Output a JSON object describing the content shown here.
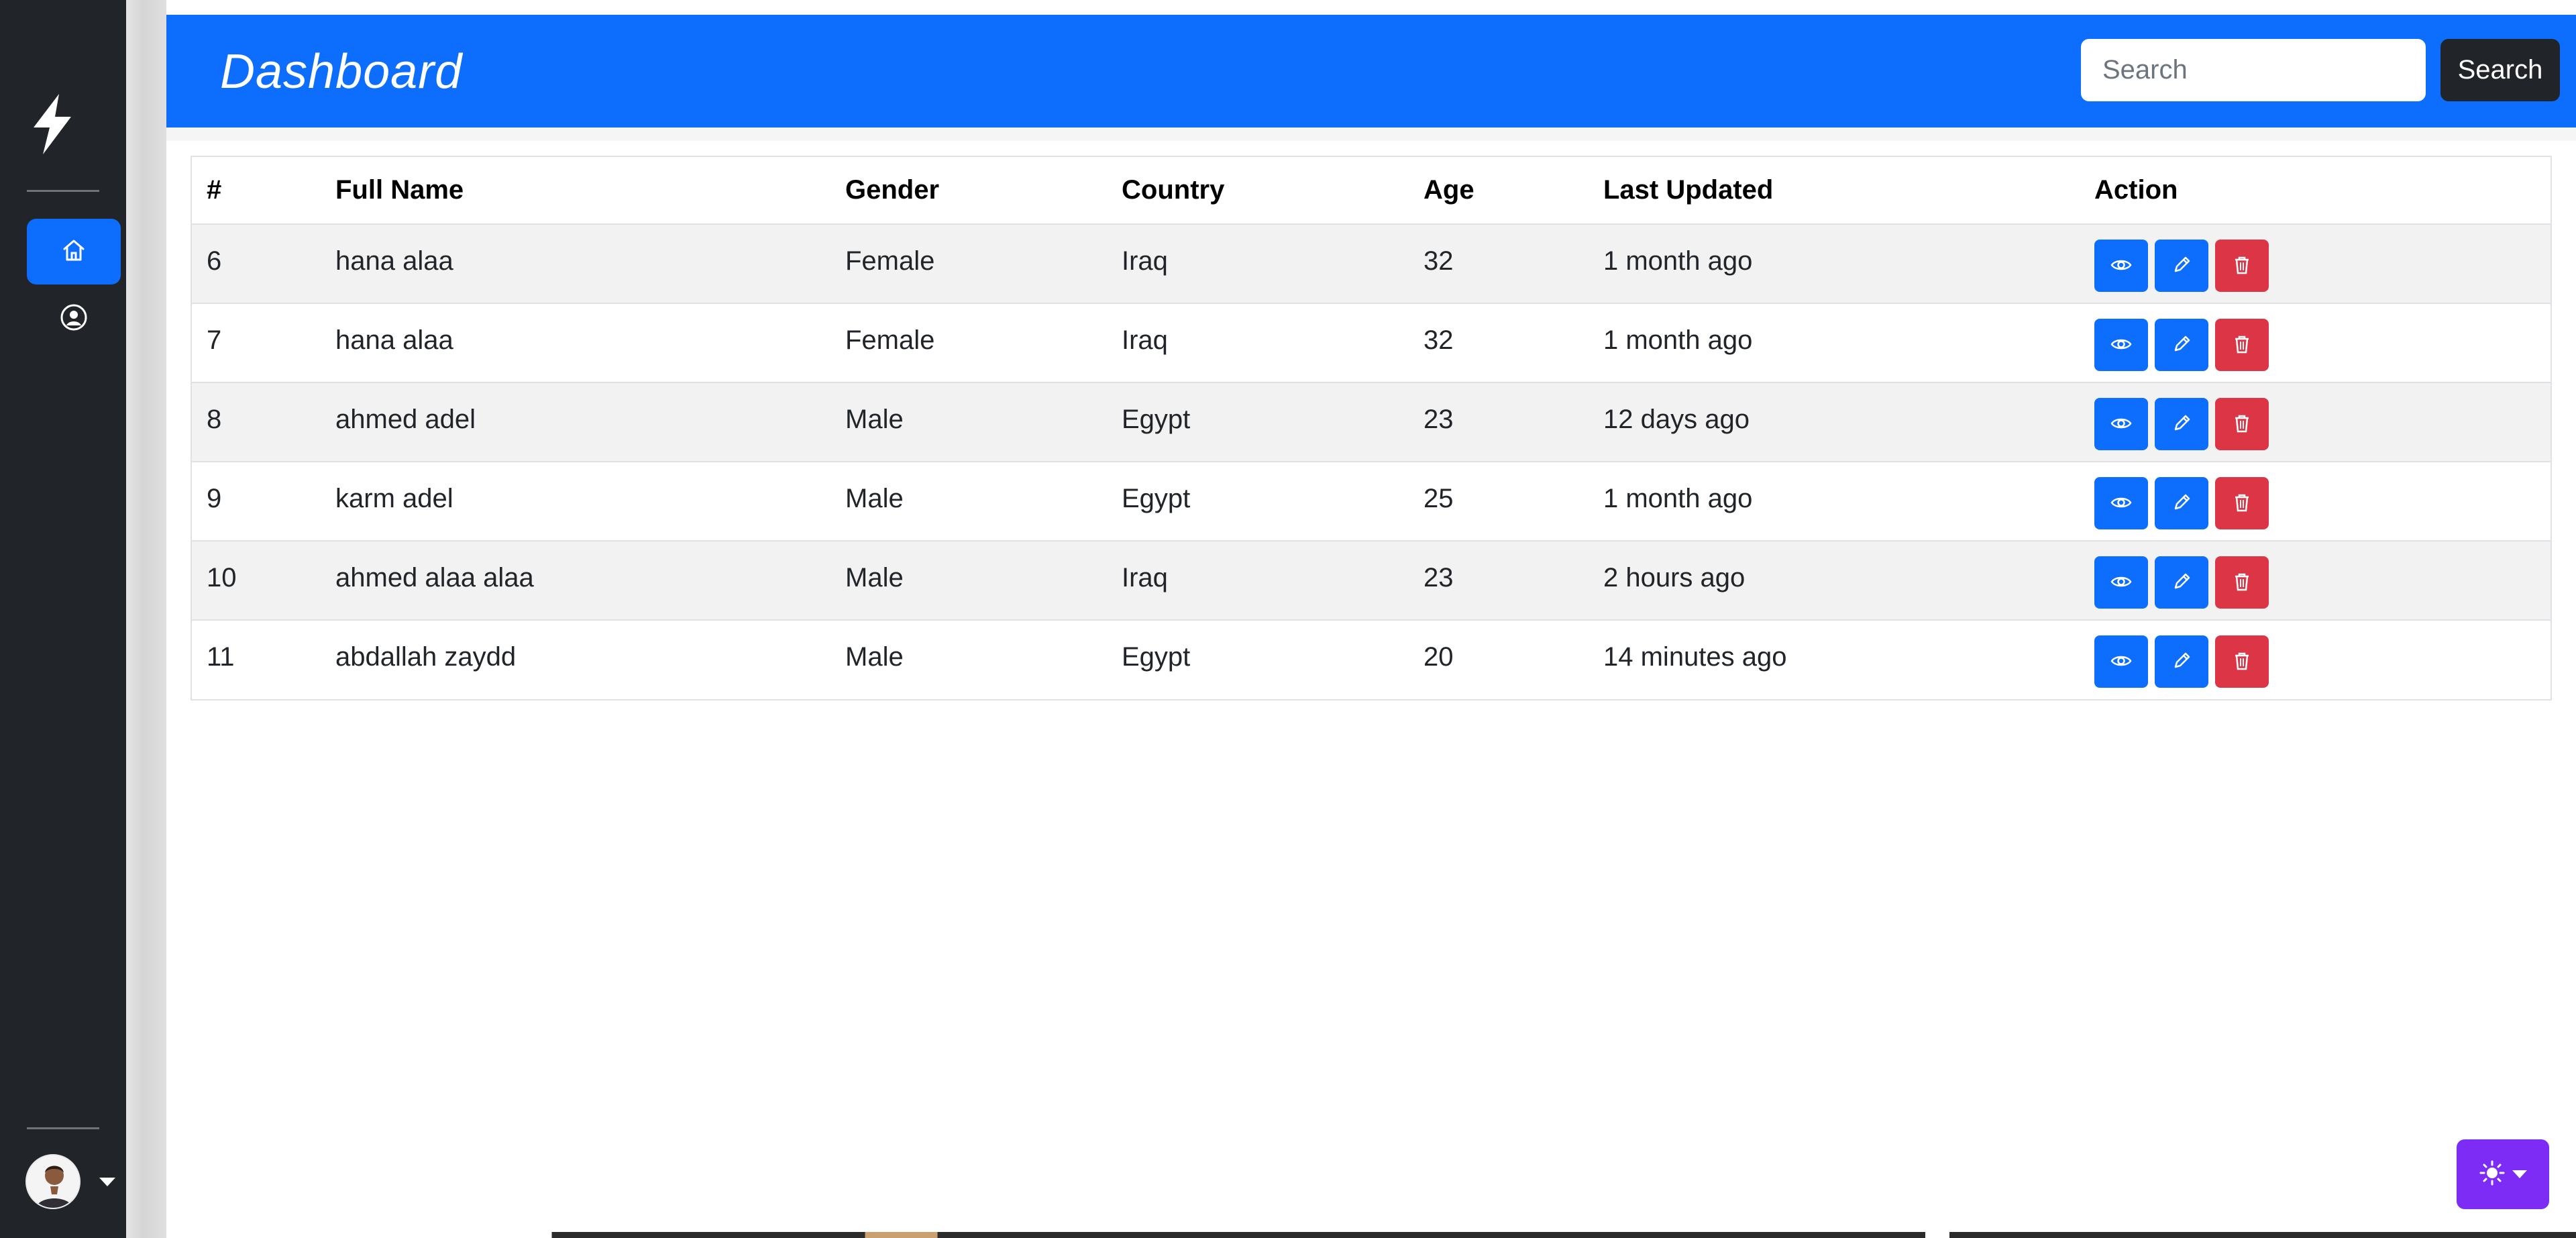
{
  "sidebar": {
    "brand_icon": "lightning-icon",
    "items": [
      {
        "icon": "house-icon",
        "active": true
      },
      {
        "icon": "user-circle-icon",
        "active": false
      }
    ],
    "user_menu": {
      "avatar": "avatar-photo",
      "caret": "caret-down-icon"
    }
  },
  "header": {
    "title": "Dashboard",
    "search_placeholder": "Search",
    "search_value": "",
    "search_button": "Search",
    "background_color": "#0d6efd"
  },
  "table": {
    "columns": [
      "#",
      "Full Name",
      "Gender",
      "Country",
      "Age",
      "Last Updated",
      "Action"
    ],
    "rows": [
      {
        "id": "6",
        "name": "hana alaa",
        "gender": "Female",
        "country": "Iraq",
        "age": "32",
        "updated": "1 month ago"
      },
      {
        "id": "7",
        "name": "hana alaa",
        "gender": "Female",
        "country": "Iraq",
        "age": "32",
        "updated": "1 month ago"
      },
      {
        "id": "8",
        "name": "ahmed adel",
        "gender": "Male",
        "country": "Egypt",
        "age": "23",
        "updated": "12 days ago"
      },
      {
        "id": "9",
        "name": "karm adel",
        "gender": "Male",
        "country": "Egypt",
        "age": "25",
        "updated": "1 month ago"
      },
      {
        "id": "10",
        "name": "ahmed alaa alaa",
        "gender": "Male",
        "country": "Iraq",
        "age": "23",
        "updated": "2 hours ago"
      },
      {
        "id": "11",
        "name": "abdallah zaydd",
        "gender": "Male",
        "country": "Egypt",
        "age": "20",
        "updated": "14 minutes ago"
      }
    ],
    "action_icons": [
      "eye-icon",
      "pencil-icon",
      "trash-icon"
    ],
    "action_colors": {
      "view": "#0d6efd",
      "edit": "#0d6efd",
      "delete": "#dc3545"
    }
  },
  "theme_toggle": {
    "icon": "sun-icon",
    "caret": "caret-down-icon",
    "color": "#7c2cf4"
  }
}
